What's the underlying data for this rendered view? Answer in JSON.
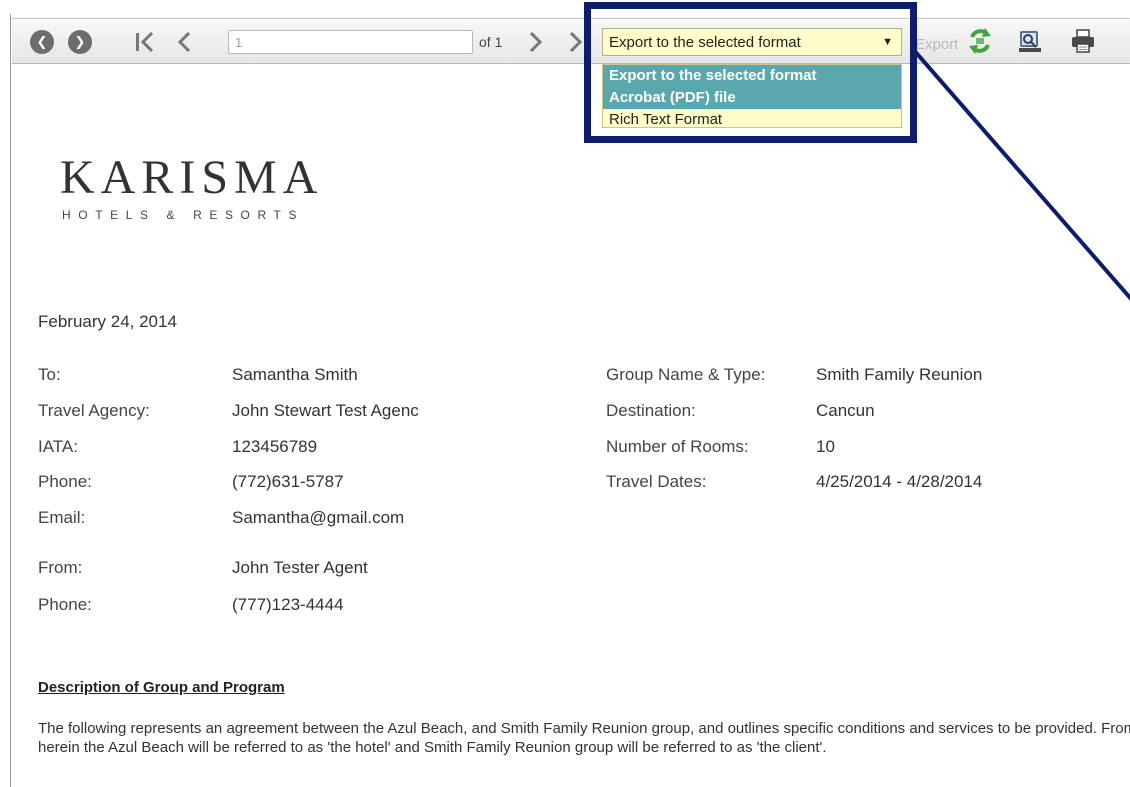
{
  "toolbar": {
    "first_page_icon": "first-page-icon",
    "page_input_value": "1",
    "of_label": "of 1",
    "export_select_value": "Export to the selected format",
    "export_label": "Export",
    "icons": [
      "back-circle-icon",
      "forward-circle-icon",
      "first-page-icon",
      "previous-page-icon",
      "next-page-icon",
      "last-page-icon",
      "refresh-icon",
      "search-icon",
      "print-icon"
    ]
  },
  "dropdown": {
    "options": [
      "Export to the selected format",
      "Acrobat (PDF) file",
      "Rich Text Format"
    ]
  },
  "logo": {
    "main": "KARISMA",
    "sub": "HOTELS & RESORTS"
  },
  "document": {
    "date": "February 24, 2014",
    "left_fields": [
      {
        "label": "To:",
        "value": "Samantha Smith"
      },
      {
        "label": "Travel Agency:",
        "value": "John Stewart Test Agenc"
      },
      {
        "label": "IATA:",
        "value": "123456789"
      },
      {
        "label": "Phone:",
        "value": "(772)631-5787"
      },
      {
        "label": "Email:",
        "value": "Samantha@gmail.com"
      },
      {
        "label": "From:",
        "value": "John Tester Agent"
      },
      {
        "label": "Phone:",
        "value": "(777)123-4444"
      }
    ],
    "right_fields": [
      {
        "label": "Group Name & Type:",
        "value": "Smith Family Reunion"
      },
      {
        "label": "Destination:",
        "value": "Cancun"
      },
      {
        "label": "Number of Rooms:",
        "value": "10"
      },
      {
        "label": "Travel Dates:",
        "value": "4/25/2014 - 4/28/2014"
      }
    ],
    "section_heading": "Description of Group and Program",
    "paragraph": "The following represents an agreement between the Azul Beach, and Smith Family Reunion group, and outlines specific conditions and services to be provided. From herein the Azul Beach will be referred to as 'the hotel' and Smith Family Reunion group will be referred to as 'the client'."
  },
  "colors": {
    "highlight_box": "#0e1d6b",
    "dropdown_bg": "#fffdc9",
    "dropdown_selected": "#5aa8ad"
  }
}
